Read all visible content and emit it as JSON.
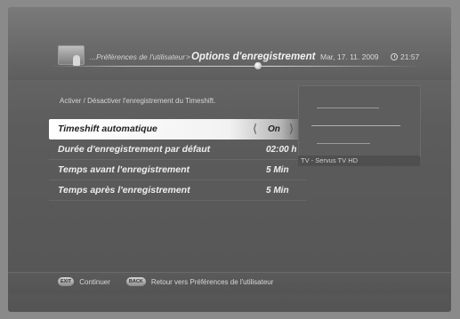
{
  "header": {
    "breadcrumb_prefix": "...Préférences de l'utilisateur",
    "breadcrumb_separator": ">",
    "title": "Options d'enregistrement",
    "date": "Mar, 17. 11. 2009",
    "time": "21:57"
  },
  "description": "Activer / Désactiver l'enregistrement du Timeshift.",
  "settings": [
    {
      "label": "Timeshift automatique",
      "value": "On"
    },
    {
      "label": "Durée d'enregistrement par défaut",
      "value": "02:00 h"
    },
    {
      "label": "Temps avant l'enregistrement",
      "value": "5 Min"
    },
    {
      "label": "Temps après l'enregistrement",
      "value": "5 Min"
    }
  ],
  "preview": {
    "channel": "TV - Servus TV HD"
  },
  "footer": {
    "exit_key": "EXIT",
    "exit_label": "Continuer",
    "back_key": "BACK",
    "back_label": "Retour vers Préférences de l'utilisateur"
  },
  "icons": {
    "left_arrow": "chevron-left-icon",
    "right_arrow": "chevron-right-icon",
    "clock": "clock-icon",
    "app": "preferences-icon"
  }
}
